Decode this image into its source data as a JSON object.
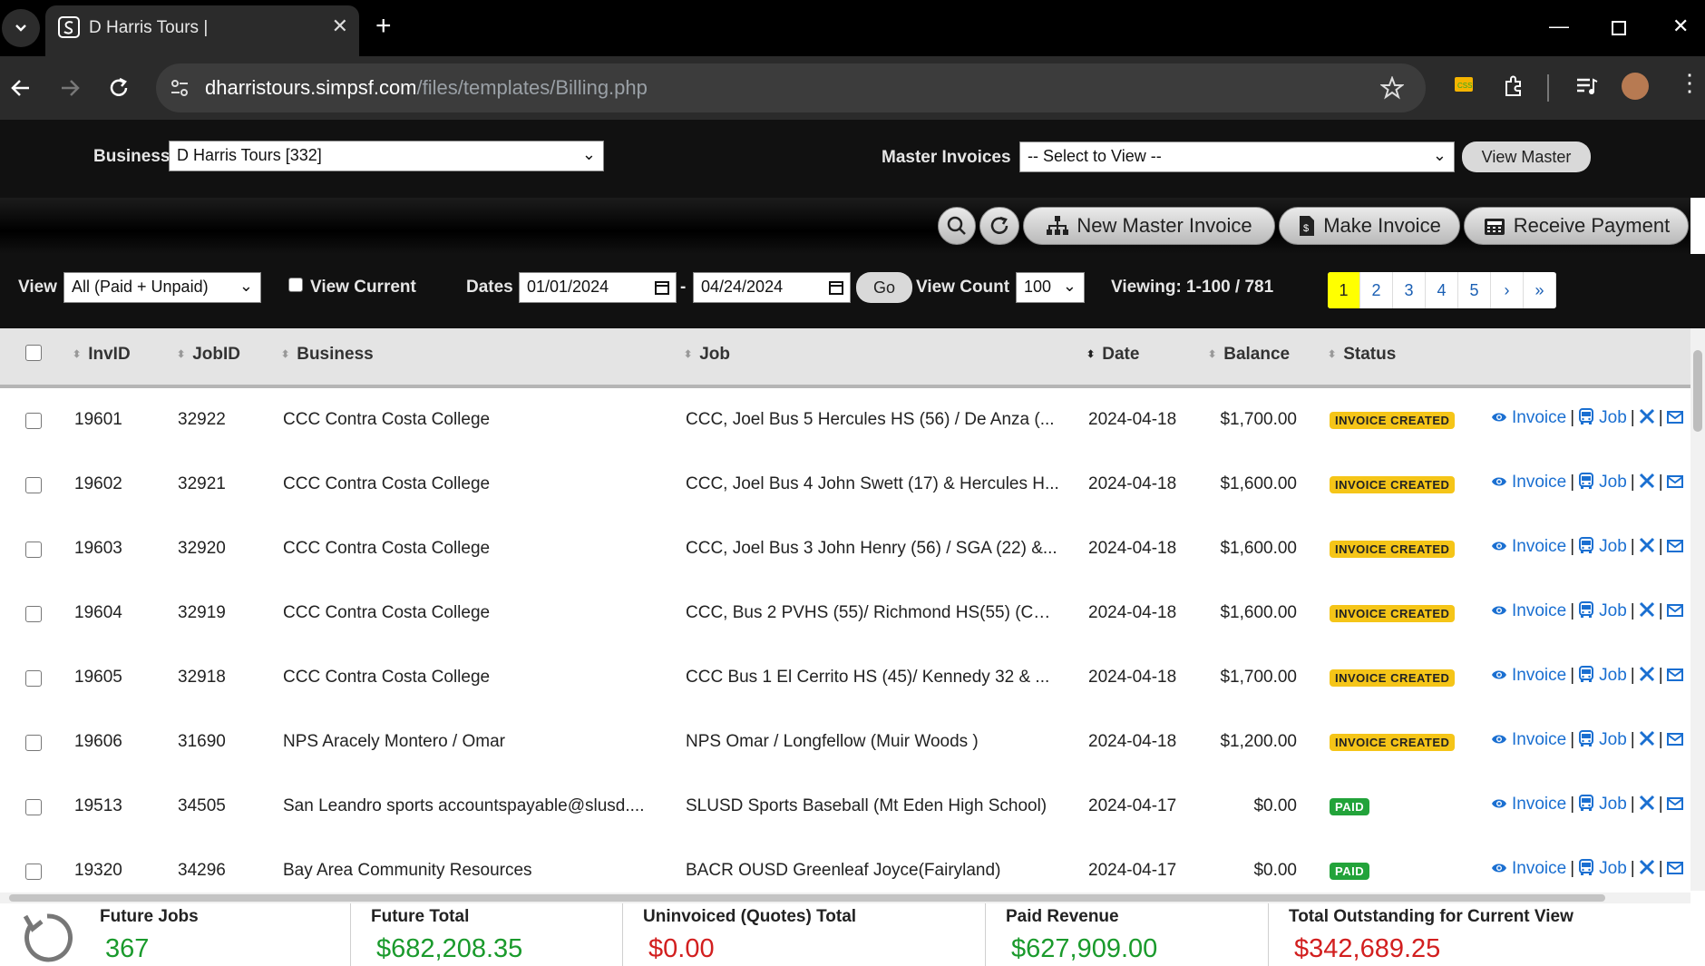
{
  "browser": {
    "tab_title": "D Harris Tours |",
    "url_host": "dharristours.simpsf.com",
    "url_path": "/files/templates/Billing.php"
  },
  "header": {
    "business_label": "Business",
    "business_value": "D Harris Tours [332]",
    "master_label": "Master Invoices",
    "master_value": "-- Select to View --",
    "view_master_label": "View Master"
  },
  "actions_bar": {
    "new_master_label": "New Master Invoice",
    "make_invoice_label": "Make Invoice",
    "receive_payment_label": "Receive Payment"
  },
  "filters": {
    "view_label": "View",
    "view_value": "All (Paid + Unpaid)",
    "view_current_label": "View Current",
    "dates_label": "Dates",
    "date_from": "01/01/2024",
    "date_sep": "-",
    "date_to": "04/24/2024",
    "go_label": "Go",
    "view_count_label": "View Count",
    "view_count_value": "100",
    "viewing_text": "Viewing: 1-100 / 781",
    "pages": [
      "1",
      "2",
      "3",
      "4",
      "5",
      "›",
      "»"
    ],
    "current_page": "1"
  },
  "table": {
    "columns": [
      "InvID",
      "JobID",
      "Business",
      "Job",
      "Date",
      "Balance",
      "Status"
    ],
    "action_invoice": "Invoice",
    "action_job": "Job",
    "rows": [
      {
        "inv": "19601",
        "job_id": "32922",
        "business": "CCC Contra Costa College",
        "job": "CCC, Joel Bus 5 Hercules HS (56) / De Anza (...",
        "date": "2024-04-18",
        "balance": "$1,700.00",
        "status": "INVOICE CREATED"
      },
      {
        "inv": "19602",
        "job_id": "32921",
        "business": "CCC Contra Costa College",
        "job": "CCC, Joel Bus 4 John Swett (17) & Hercules H...",
        "date": "2024-04-18",
        "balance": "$1,600.00",
        "status": "INVOICE CREATED"
      },
      {
        "inv": "19603",
        "job_id": "32920",
        "business": "CCC Contra Costa College",
        "job": "CCC, Joel Bus 3 John Henry (56) / SGA (22) &...",
        "date": "2024-04-18",
        "balance": "$1,600.00",
        "status": "INVOICE CREATED"
      },
      {
        "inv": "19604",
        "job_id": "32919",
        "business": "CCC Contra Costa College",
        "job": "CCC, Bus 2 PVHS (55)/ Richmond HS(55) (CC...",
        "date": "2024-04-18",
        "balance": "$1,600.00",
        "status": "INVOICE CREATED"
      },
      {
        "inv": "19605",
        "job_id": "32918",
        "business": "CCC Contra Costa College",
        "job": "CCC Bus 1 El Cerrito HS (45)/ Kennedy 32 & ...",
        "date": "2024-04-18",
        "balance": "$1,700.00",
        "status": "INVOICE CREATED"
      },
      {
        "inv": "19606",
        "job_id": "31690",
        "business": "NPS Aracely Montero / Omar",
        "job": "NPS Omar / Longfellow (Muir Woods )",
        "date": "2024-04-18",
        "balance": "$1,200.00",
        "status": "INVOICE CREATED"
      },
      {
        "inv": "19513",
        "job_id": "34505",
        "business": "San Leandro sports accountspayable@slusd....",
        "job": "SLUSD Sports Baseball (Mt Eden High School)",
        "date": "2024-04-17",
        "balance": "$0.00",
        "status": "PAID"
      },
      {
        "inv": "19320",
        "job_id": "34296",
        "business": "Bay Area Community Resources",
        "job": "BACR OUSD Greenleaf Joyce(Fairyland)",
        "date": "2024-04-17",
        "balance": "$0.00",
        "status": "PAID"
      }
    ]
  },
  "footer": {
    "stats": [
      {
        "title": "Future Jobs",
        "value": "367",
        "color": "#1a9a2c"
      },
      {
        "title": "Future Total",
        "value": "$682,208.35",
        "color": "#1a9a2c"
      },
      {
        "title": "Uninvoiced (Quotes) Total",
        "value": "$0.00",
        "color": "#d21f1f"
      },
      {
        "title": "Paid Revenue",
        "value": "$627,909.00",
        "color": "#1a9a2c"
      },
      {
        "title": "Total Outstanding for Current View",
        "value": "$342,689.25",
        "color": "#d21f1f"
      }
    ]
  },
  "colors": {
    "link": "#1a6fd1",
    "badge_invoice": "#f5c518",
    "badge_paid": "#22a33a",
    "current_page": "#ffff00"
  }
}
